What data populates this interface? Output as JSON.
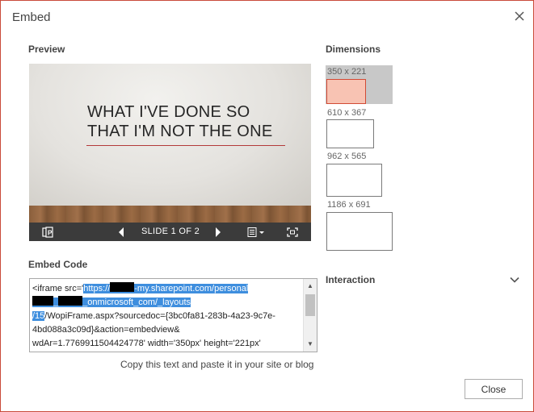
{
  "dialog": {
    "title": "Embed",
    "close_label": "Close"
  },
  "preview": {
    "label": "Preview",
    "slide_title_line1": "WHAT I'VE DONE SO",
    "slide_title_line2": "THAT I'M NOT THE ONE",
    "slide_counter": "SLIDE 1 OF 2",
    "controls": [
      "powerpoint-icon",
      "prev-arrow-icon",
      "next-arrow-icon",
      "notes-menu-icon",
      "fullscreen-icon"
    ]
  },
  "dimensions": {
    "label": "Dimensions",
    "options": [
      {
        "label": "350 x 221",
        "selected": true
      },
      {
        "label": "610 x 367",
        "selected": false
      },
      {
        "label": "962 x 565",
        "selected": false
      },
      {
        "label": "1186 x 691",
        "selected": false
      }
    ]
  },
  "embed": {
    "label": "Embed Code",
    "line1_a": "<iframe src='",
    "line1_b": "https://",
    "line1_c": "-my.sharepoint.com/personal",
    "line2_b": "_onmicrosoft_com/_layouts",
    "line3_a": "/15",
    "line3_b": "/WopiFrame.aspx?sourcedoc={3bc0fa81-283b-4a23-9c7e-",
    "line4": "4bd088a3c09d}&action=embedview&",
    "line5": "wdAr=1.7769911504424778' width='350px' height='221px'",
    "hint": "Copy this text and paste it in your site or blog"
  },
  "interaction": {
    "label": "Interaction"
  },
  "colors": {
    "accent_border": "#c94a3a",
    "selection": "#3e8ede",
    "selected_size": "#f8c3b3"
  }
}
